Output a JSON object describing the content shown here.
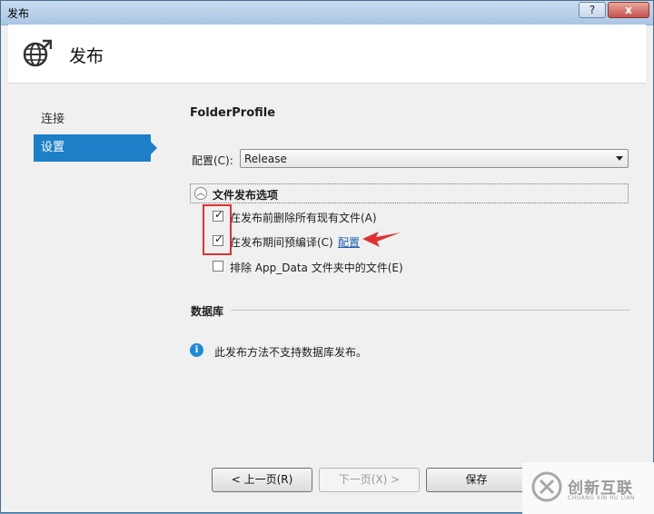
{
  "window": {
    "title": "发布",
    "help_button": "?",
    "close_button": "x"
  },
  "header": {
    "title": "发布",
    "icon": "globe-publish-icon"
  },
  "nav": {
    "items": [
      {
        "label": "连接",
        "active": false
      },
      {
        "label": "设置",
        "active": true
      }
    ],
    "active_color": "#1e7fc9"
  },
  "settings": {
    "profile_name": "FolderProfile",
    "config_label": "配置(C):",
    "config_value": "Release",
    "section_title": "文件发布选项",
    "options": [
      {
        "label": "在发布前删除所有现有文件(A)",
        "checked": true
      },
      {
        "label": "在发布期间预编译(C)",
        "checked": true,
        "link": "配置"
      },
      {
        "label": "排除 App_Data 文件夹中的文件(E)",
        "checked": false
      }
    ],
    "database_title": "数据库",
    "database_info": "此发布方法不支持数据库发布。"
  },
  "buttons": {
    "prev": "< 上一页(R)",
    "next": "下一页(X) >",
    "save": "保存"
  },
  "watermark": {
    "name": "创新互联",
    "subtitle": "CHUANG XIN HU LIAN"
  },
  "annotation_color": "#e03030"
}
